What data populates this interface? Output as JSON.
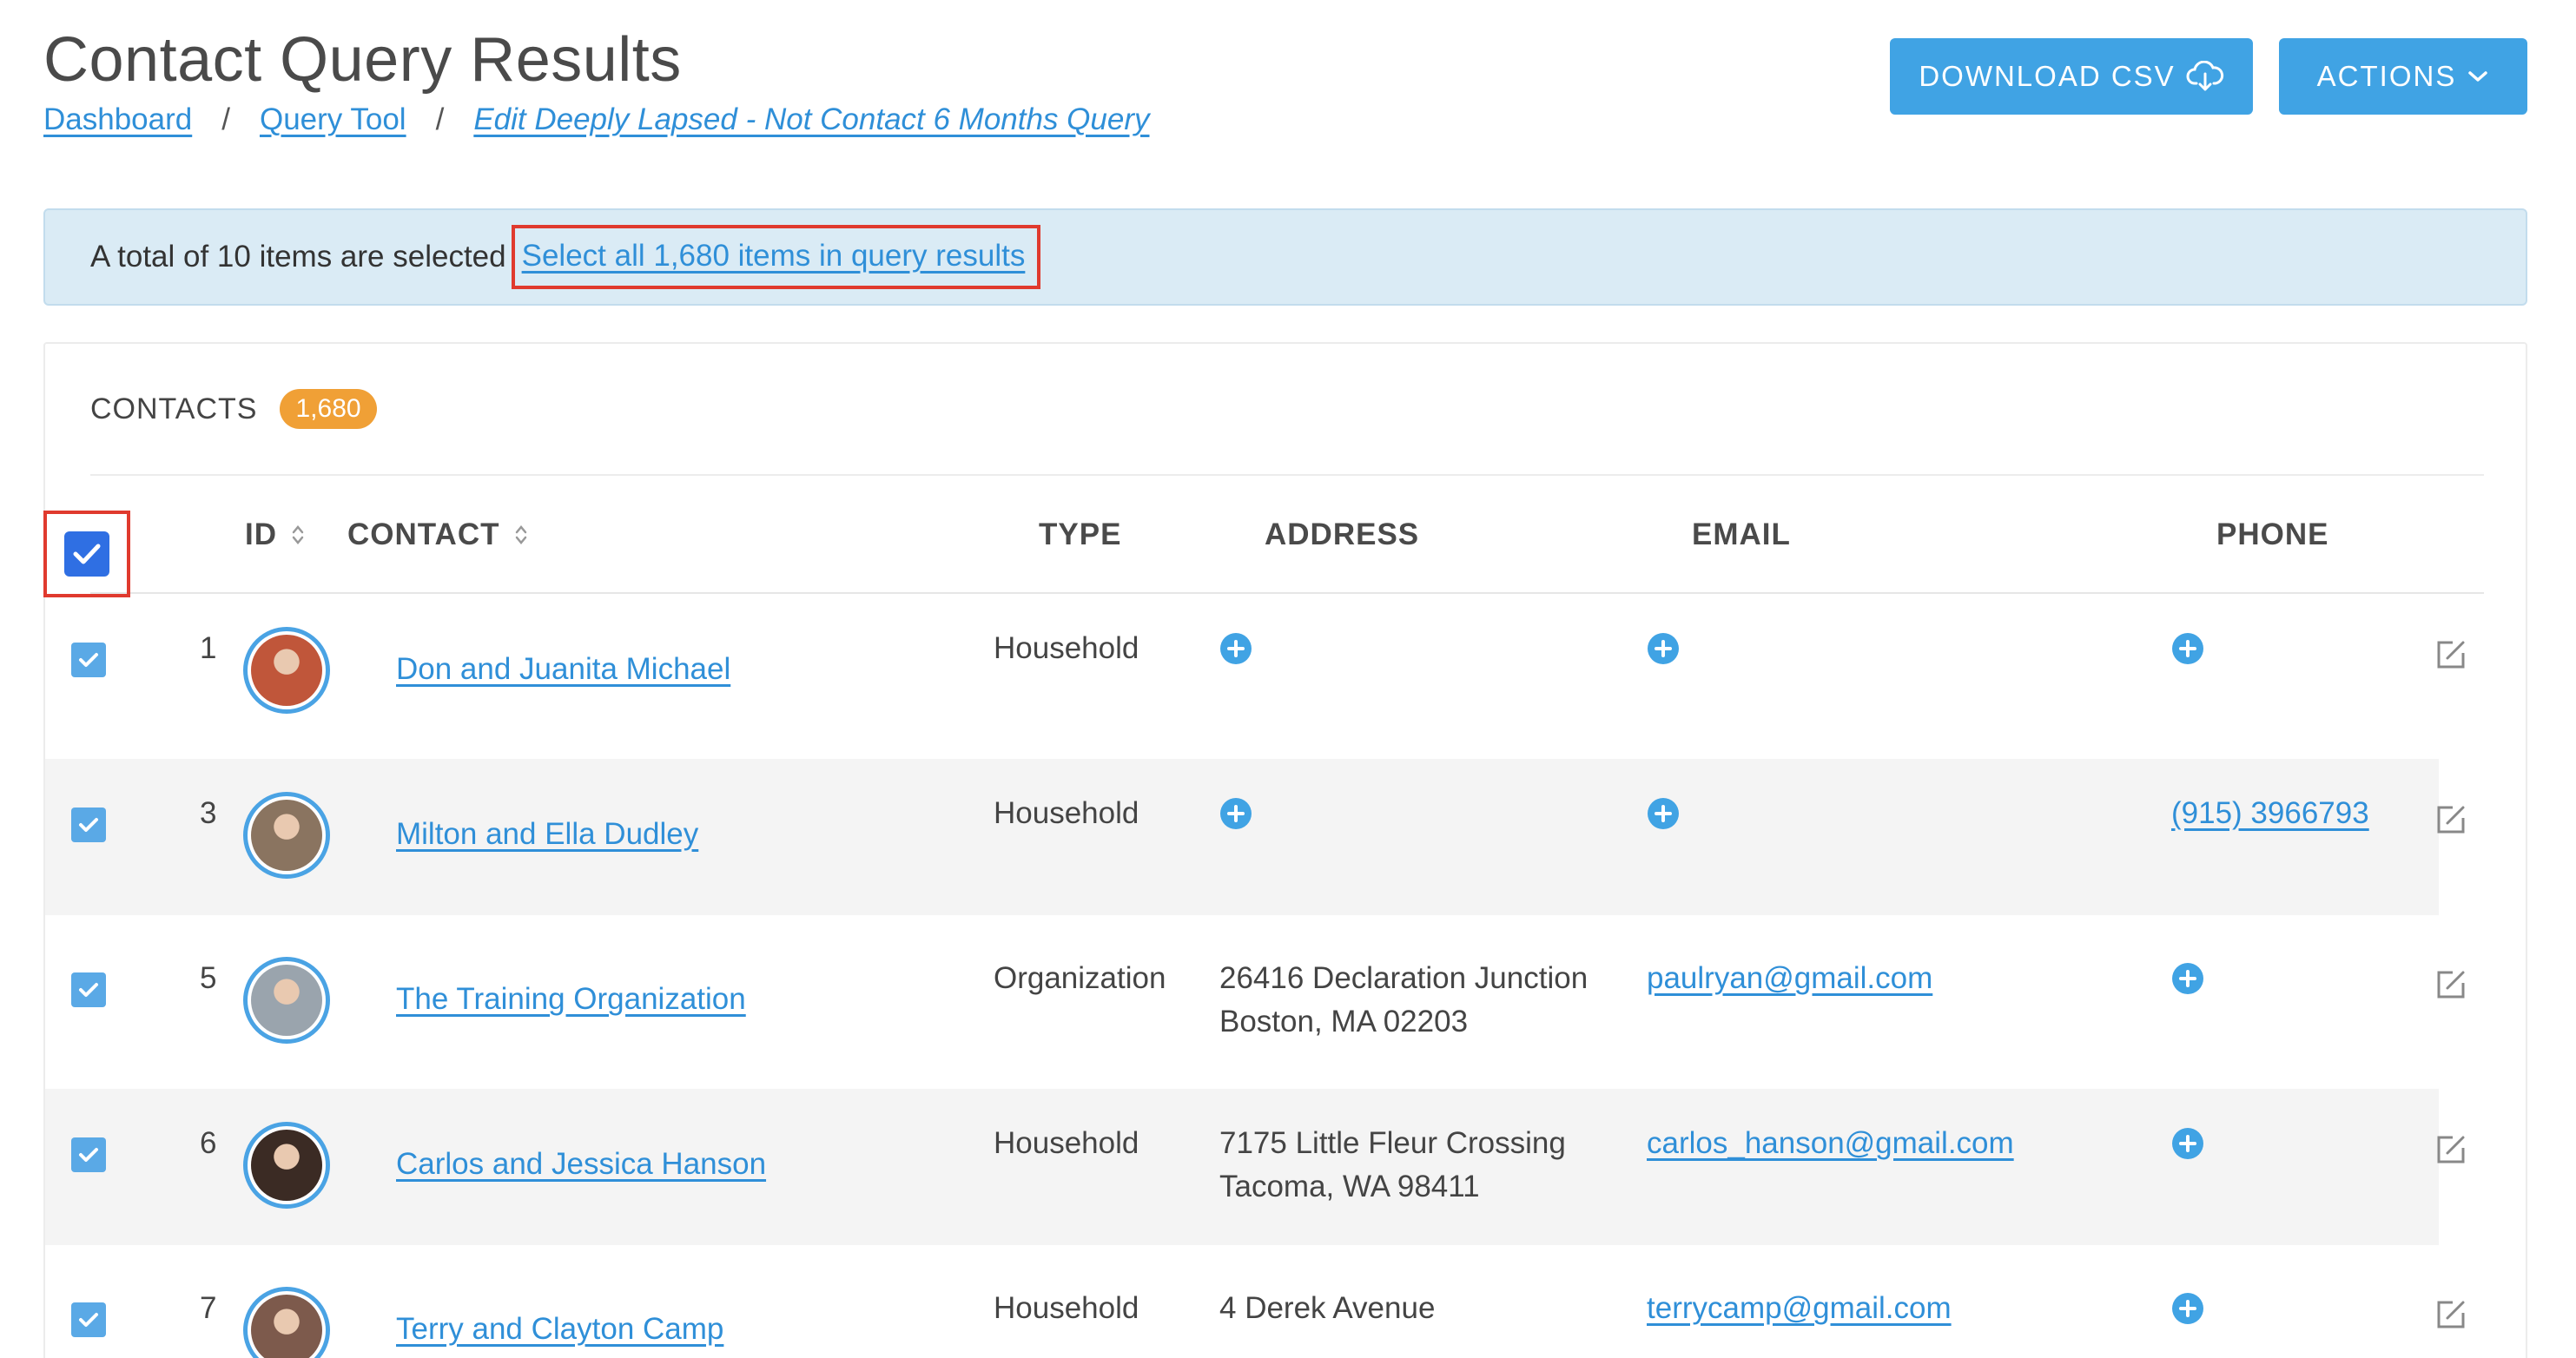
{
  "page": {
    "title": "Contact Query Results",
    "breadcrumb": [
      "Dashboard",
      "Query Tool",
      "Edit Deeply Lapsed - Not Contact 6 Months Query"
    ]
  },
  "buttons": {
    "download": "DOWNLOAD CSV",
    "actions": "ACTIONS"
  },
  "alert": {
    "text": "A total of 10 items are selected",
    "link": "Select all 1,680 items in query results"
  },
  "card": {
    "title": "CONTACTS",
    "count": "1,680"
  },
  "table": {
    "columns": [
      "ID",
      "CONTACT",
      "TYPE",
      "ADDRESS",
      "EMAIL",
      "PHONE"
    ],
    "rows": [
      {
        "id": "1",
        "contact": "Don and Juanita Michael",
        "type": "Household",
        "address1": "",
        "address2": "",
        "email": "",
        "phone": ""
      },
      {
        "id": "3",
        "contact": "Milton and Ella Dudley",
        "type": "Household",
        "address1": "",
        "address2": "",
        "email": "",
        "phone": "(915) 3966793"
      },
      {
        "id": "5",
        "contact": "The Training Organization",
        "type": "Organization",
        "address1": "26416 Declaration Junction",
        "address2": "Boston, MA 02203",
        "email": "paulryan@gmail.com",
        "phone": ""
      },
      {
        "id": "6",
        "contact": "Carlos and Jessica Hanson",
        "type": "Household",
        "address1": "7175 Little Fleur Crossing",
        "address2": "Tacoma, WA 98411",
        "email": "carlos_hanson@gmail.com",
        "phone": ""
      },
      {
        "id": "7",
        "contact": "Terry and Clayton Camp",
        "type": "Household",
        "address1": "4 Derek Avenue",
        "address2": "",
        "email": "terrycamp@gmail.com",
        "phone": ""
      }
    ]
  },
  "colors": {
    "primary": "#40a3e4",
    "link": "#2f8fd8",
    "alert_bg": "#daebf5",
    "badge": "#f0a036",
    "highlight": "#e03a2e"
  }
}
